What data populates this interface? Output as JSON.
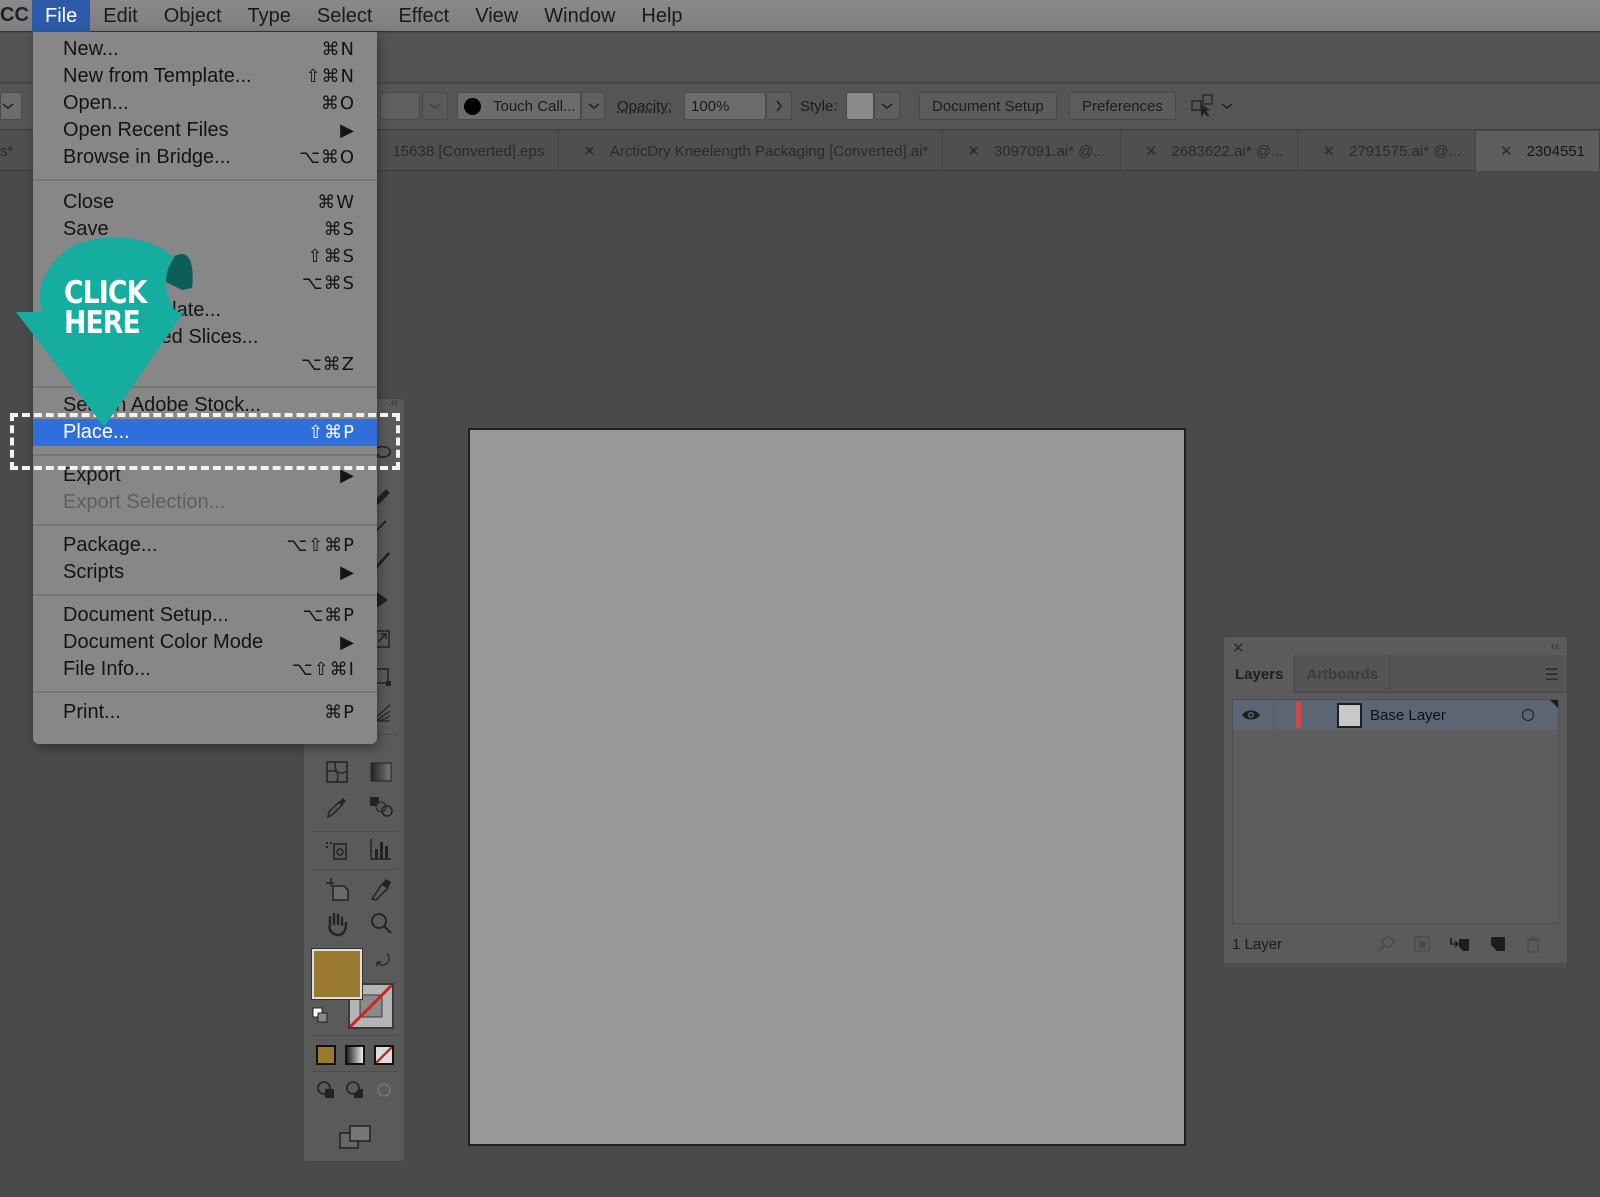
{
  "menubar": {
    "app_label": "CC",
    "items": [
      "File",
      "Edit",
      "Object",
      "Type",
      "Select",
      "Effect",
      "View",
      "Window",
      "Help"
    ],
    "active": "File"
  },
  "options_bar": {
    "brush_name": "Touch Call...",
    "opacity_label": "Opacity:",
    "opacity_value": "100%",
    "style_label": "Style:",
    "document_setup_label": "Document Setup",
    "preferences_label": "Preferences"
  },
  "tabs": [
    {
      "label": "15638 [Converted].eps",
      "active": false
    },
    {
      "label": "ArcticDry Kneelength Packaging [Converted].ai*",
      "active": false
    },
    {
      "label": "3097091.ai* @...",
      "active": false
    },
    {
      "label": "2683622.ai* @...",
      "active": false
    },
    {
      "label": "2791575.ai* @...",
      "active": false
    },
    {
      "label": "2304551",
      "active": true
    }
  ],
  "file_menu": {
    "items": [
      {
        "label": "New...",
        "shortcut": "⌘N"
      },
      {
        "label": "New from Template...",
        "shortcut": "⇧⌘N"
      },
      {
        "label": "Open...",
        "shortcut": "⌘O"
      },
      {
        "label": "Open Recent Files",
        "shortcut": "▶"
      },
      {
        "label": "Browse in Bridge...",
        "shortcut": "⌥⌘O"
      },
      {
        "label": "Close",
        "shortcut": "⌘W"
      },
      {
        "label": "Save",
        "shortcut": "⌘S"
      },
      {
        "label": "",
        "shortcut": "⇧⌘S"
      },
      {
        "label": "",
        "shortcut": "⌥⌘S"
      },
      {
        "label": "plate...",
        "shortcut": ""
      },
      {
        "label": "ted Slices...",
        "shortcut": ""
      },
      {
        "label": "",
        "shortcut": "⌥⌘Z"
      },
      {
        "label": "Search Adobe Stock...",
        "shortcut": ""
      },
      {
        "label": "Place...",
        "shortcut": "⇧⌘P",
        "highlighted": true
      },
      {
        "label": "Export",
        "shortcut": "▶"
      },
      {
        "label": "Export Selection...",
        "shortcut": "",
        "disabled": true
      },
      {
        "label": "Package...",
        "shortcut": "⌥⇧⌘P"
      },
      {
        "label": "Scripts",
        "shortcut": "▶"
      },
      {
        "label": "Document Setup...",
        "shortcut": "⌥⌘P"
      },
      {
        "label": "Document Color Mode",
        "shortcut": "▶"
      },
      {
        "label": "File Info...",
        "shortcut": "⌥⇧⌘I"
      },
      {
        "label": "Print...",
        "shortcut": "⌘P"
      }
    ]
  },
  "callout": {
    "line1": "CLICK",
    "line2": "HERE",
    "color": "#14ada0"
  },
  "colors": {
    "fill": "#9a7a2e",
    "highlight": "#2f6fdb",
    "layer_color": "#d04848"
  },
  "layers_panel": {
    "tabs": [
      "Layers",
      "Artboards"
    ],
    "active_tab": "Layers",
    "layers": [
      {
        "name": "Base Layer",
        "visible": true
      }
    ],
    "footer_count": "1 Layer"
  }
}
